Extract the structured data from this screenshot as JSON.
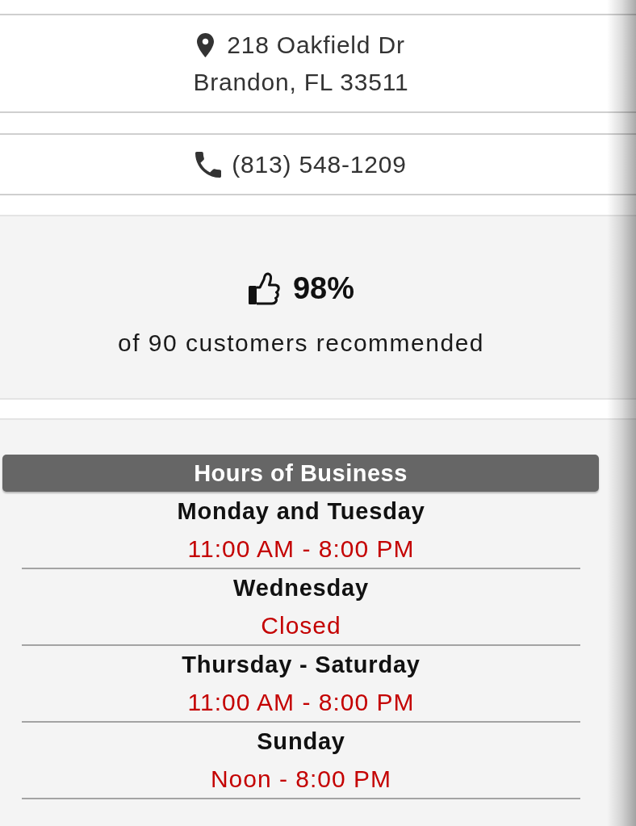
{
  "address": {
    "line1": "218 Oakfield Dr",
    "line2": "Brandon, FL 33511"
  },
  "phone": {
    "number": "(813) 548-1209"
  },
  "recommendation": {
    "percent": "98%",
    "caption": "of 90 customers recommended"
  },
  "hours": {
    "title": "Hours of Business",
    "rows": [
      {
        "days": "Monday and Tuesday",
        "time": "11:00 AM - 8:00 PM"
      },
      {
        "days": "Wednesday",
        "time": "Closed"
      },
      {
        "days": "Thursday - Saturday",
        "time": "11:00 AM - 8:00 PM"
      },
      {
        "days": "Sunday",
        "time": "Noon - 8:00 PM"
      }
    ]
  }
}
